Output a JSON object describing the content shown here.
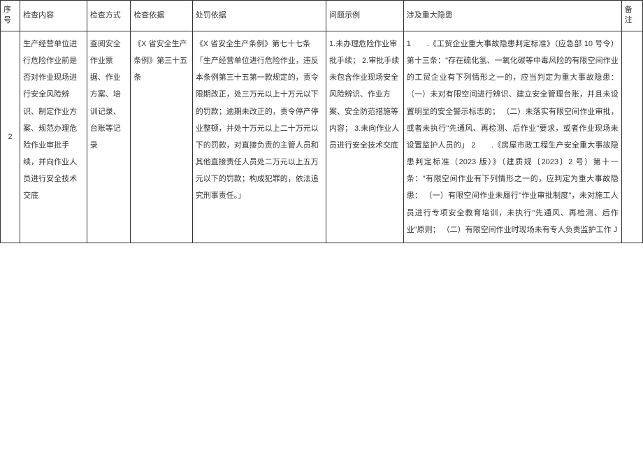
{
  "headers": {
    "seq": "序号",
    "content": "检查内容",
    "method": "检查方式",
    "basis": "检查依据",
    "penalty": "处罚依据",
    "example": "问题示例",
    "hazard": "涉及重大隐患",
    "remark": "备注"
  },
  "row": {
    "seq": "2",
    "content": "生产经营单位进行危险作业前是否对作业现场进行安全风险辨识、制定作业方案、规范办理危险作业审批手续，并向作业人员进行安全技术交底",
    "method": "查阅安全作业票据、作业方案、培训记录、台账等记录",
    "basis": "《X 省安全生产条例》第三十五条",
    "penalty": "《X 省安全生产条例》第七十七条「生产经营单位进行危险作业，违反本条例第三十五第一款规定的，责令限期改正，处三万元以上十万元以下的罚款；逾期未改正的，责令停产停业整顿，并处十万元以上二十万元以下的罚款，对直接负责的主管人员和其他直接责任人员处二万元以上五万元以下的罚款；构成犯罪的，依法追究刑事责任。」",
    "example": "1.未办理危险作业审批手续；\n2.审批手续未包含作业现场安全风险辨识、作业方案、安全防范措施等内容；\n3.未向作业人员进行安全技术交底",
    "hazard": "1　　.《工贸企业重大事故隐患判定标准》（应急部 10 号令）第十三条：\"存在硫化氢、一氧化碳等中毒风险的有限空间作业的工贸企业有下列情形之一的，应当判定为重大事故隐患：（一）未对有限空间进行辨识、建立安全管理台账，并且未设置明显的安全警示标志的；\n（二）未落实有限空间作业审批，或者未执行\"先通风、再检测、后作业\"要求，或者作业现场未设置监护人员的」\n2　　.《房屋市政工程生产安全重大事故隐患判定标准（2023 版）》（建质规〔2023〕2 号）第十一条：\"有限空间作业有下列情形之一的，应判定为重大事故隐患：\n（一）有限空间作业未履行\"作业审批制度\"，未对施工人员进行专项安全教育培训，未执行\"先通风、再检测、后作业\"原则；\n（二）有限空间作业时现场未有专人负责监护工作 J",
    "remark": ""
  }
}
